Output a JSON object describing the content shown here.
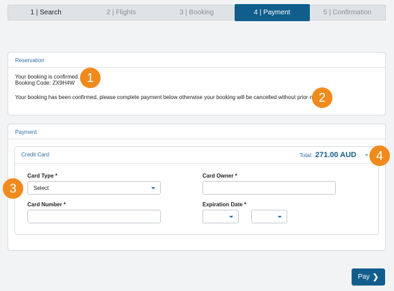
{
  "steps": [
    "1 | Search",
    "2 | Flights",
    "3 | Booking",
    "4 | Payment",
    "5 | Confirmation"
  ],
  "active_step": 4,
  "reservation": {
    "title": "Reservation",
    "line1": "Your booking is confirmed.",
    "line2": "Booking Code: ZX9H4W",
    "notice": "Your booking has been confirmed, please complete payment below otherwise your booking will be cancelled without prior notice."
  },
  "payment": {
    "title": "Payment",
    "credit_card": {
      "title": "Credit Card",
      "total_label": "Total:",
      "total_value": "271.00 AUD",
      "card_type_label": "Card Type *",
      "card_type_value": "Select",
      "card_owner_label": "Card Owner *",
      "card_owner_value": "",
      "card_number_label": "Card Number *",
      "card_number_value": "",
      "expiration_label": "Expiration Date *",
      "exp_month_value": "",
      "exp_year_value": ""
    }
  },
  "pay_button": {
    "label": "Pay",
    "icon": "chevron-right-icon"
  },
  "badges": [
    "1",
    "2",
    "3",
    "4"
  ],
  "colors": {
    "primary": "#115e8c",
    "link": "#2a70a8",
    "badge": "#f08a1c"
  }
}
